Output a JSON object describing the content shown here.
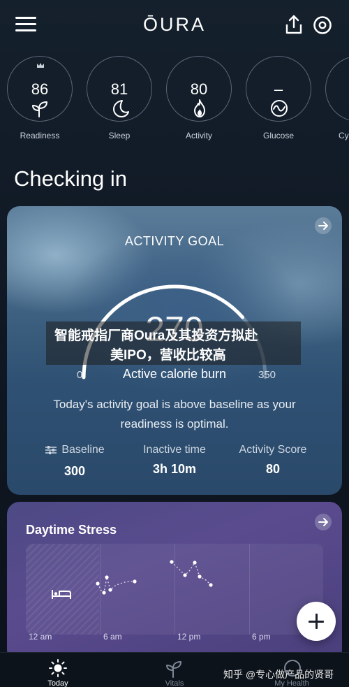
{
  "header": {
    "logo": "ŌURA"
  },
  "scores": [
    {
      "value": "86",
      "label": "Readiness",
      "icon": "sprout-icon"
    },
    {
      "value": "81",
      "label": "Sleep",
      "icon": "moon-icon"
    },
    {
      "value": "80",
      "label": "Activity",
      "icon": "flame-icon"
    },
    {
      "value": "–",
      "label": "Glucose",
      "icon": "glucose-icon"
    },
    {
      "value": "",
      "label": "Cy",
      "icon": "cycle-icon"
    }
  ],
  "section_title": "Checking in",
  "activity_card": {
    "title": "ACTIVITY GOAL",
    "gauge_value": "270",
    "gauge_min": "0",
    "gauge_max": "350",
    "gauge_label": "Active calorie burn",
    "gauge_fraction": 0.77,
    "description": "Today's activity goal is above baseline as your readiness is optimal.",
    "stats": [
      {
        "label": "Baseline",
        "value": "300"
      },
      {
        "label": "Inactive time",
        "value": "3h 10m"
      },
      {
        "label": "Activity Score",
        "value": "80"
      }
    ]
  },
  "overlay_banner": {
    "line1": "智能戒指厂商Oura及其投资方拟赴",
    "line2": "美IPO，营收比较高"
  },
  "stress_card": {
    "title": "Daytime Stress",
    "ticks": [
      "12 am",
      "6 am",
      "12 pm",
      "6 pm"
    ]
  },
  "bottom_nav": [
    {
      "label": "Today",
      "icon": "sun-icon",
      "active": true
    },
    {
      "label": "Vitals",
      "icon": "sprout-icon",
      "active": false
    },
    {
      "label": "My Health",
      "icon": "health-icon",
      "active": false
    }
  ],
  "watermark": "知乎 @专心做产品的贤哥",
  "colors": {
    "activity_card": "#3f6282",
    "stress_card": "#5a4b8e",
    "background": "#0e1622"
  }
}
